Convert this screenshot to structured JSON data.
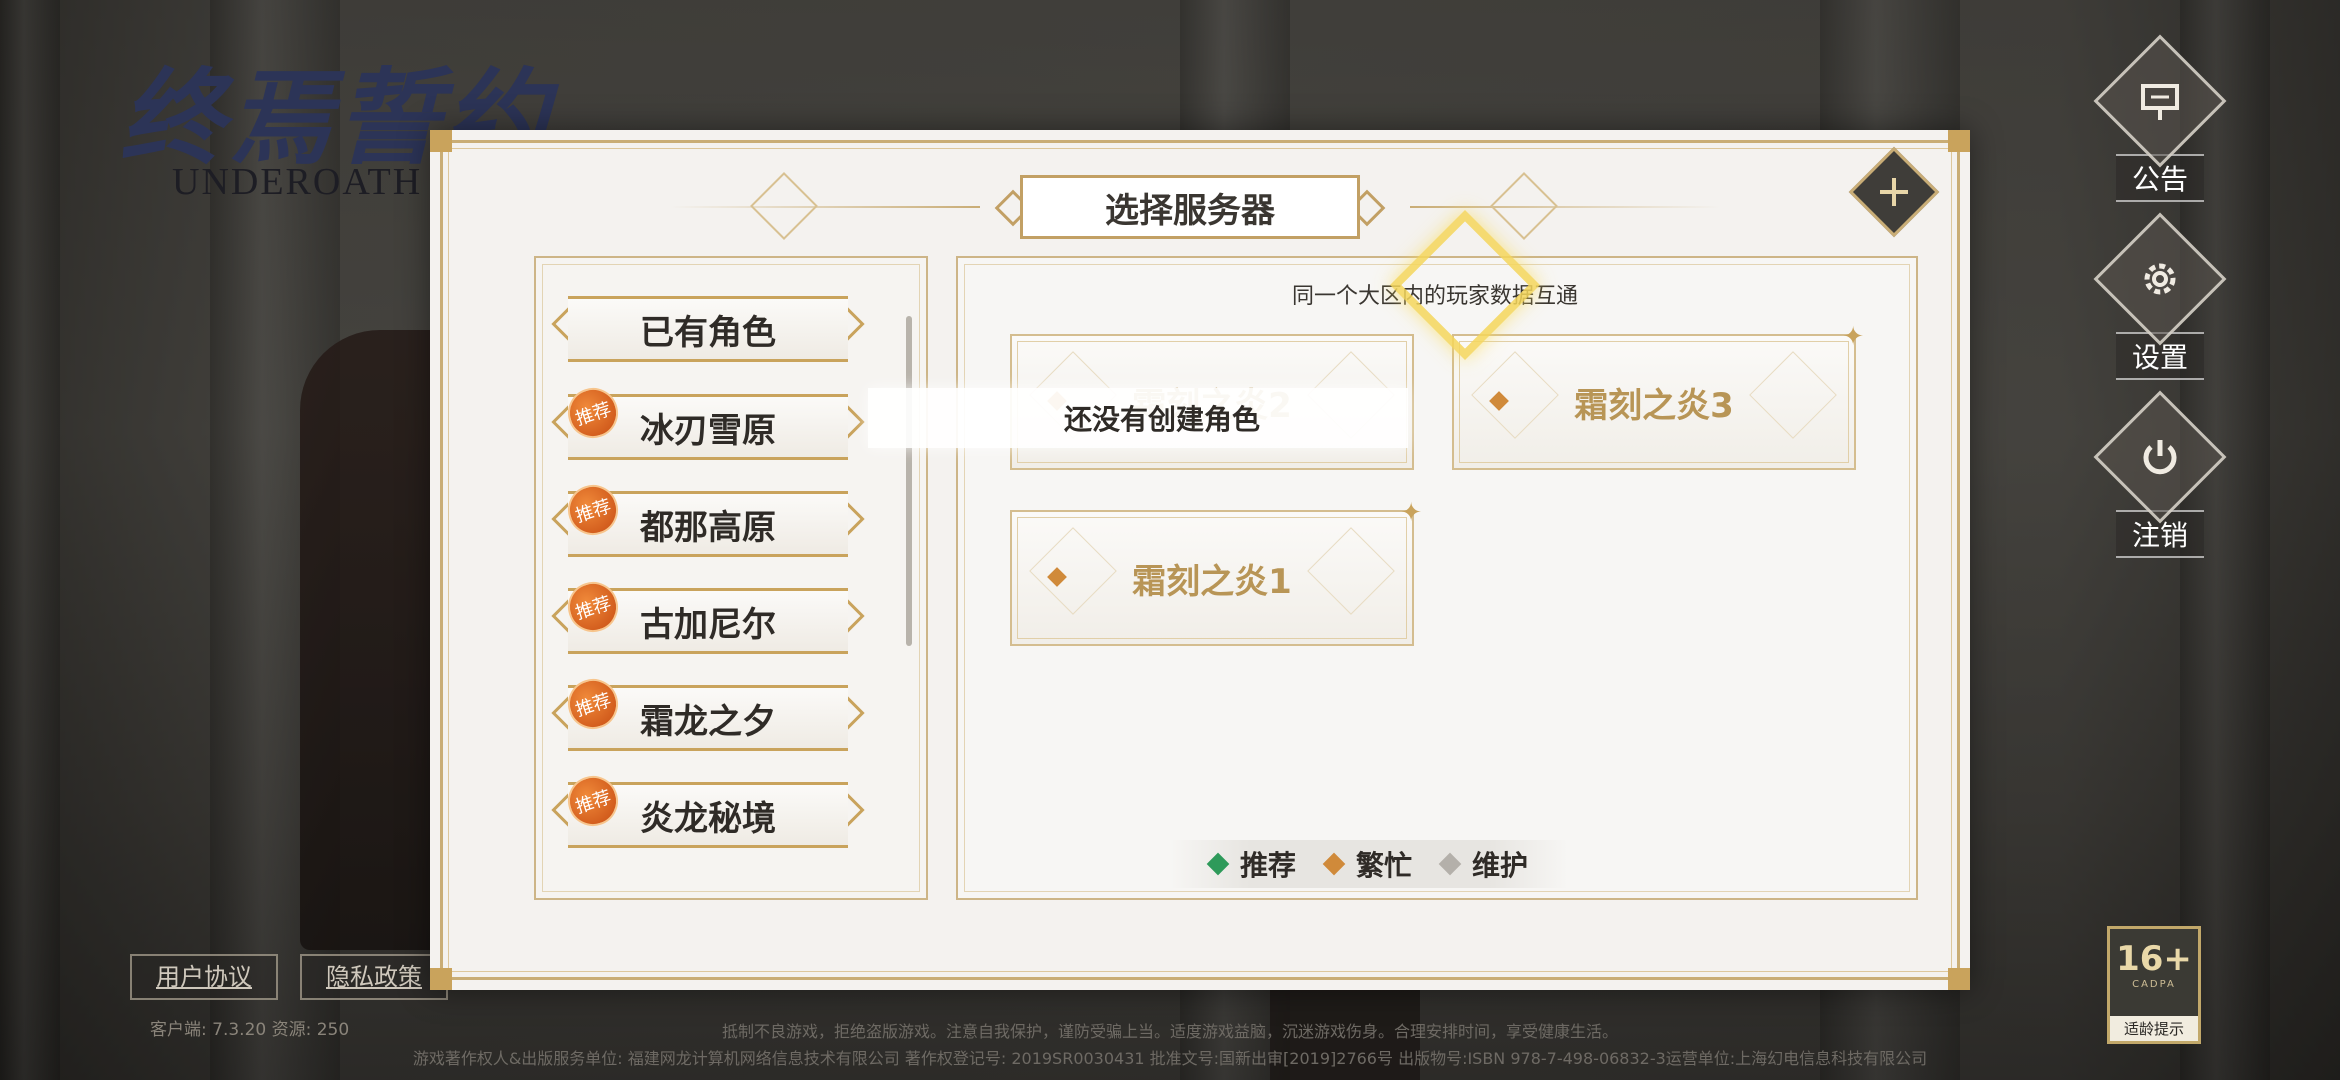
{
  "logo": {
    "cn": "终焉誓约",
    "en": "UNDEROATH"
  },
  "right_menu": [
    {
      "label": "公告",
      "icon": "notice-board-icon"
    },
    {
      "label": "设置",
      "icon": "gear-icon"
    },
    {
      "label": "注销",
      "icon": "power-icon"
    }
  ],
  "bottom_links": {
    "user_agreement": "用户协议",
    "privacy_policy": "隐私政策"
  },
  "version_text": "客户端: 7.3.20  资源: 250",
  "legal": {
    "line1": "抵制不良游戏，拒绝盗版游戏。注意自我保护，谨防受骗上当。适度游戏益脑，沉迷游戏伤身。合理安排时间，享受健康生活。",
    "line2": "游戏著作权人&出版服务单位: 福建网龙计算机网络信息技术有限公司   著作权登记号: 2019SR0030431   批准文号:国新出审[2019]2766号   出版物号:ISBN 978-7-498-06832-3运营单位:上海幻电信息科技有限公司"
  },
  "age_rating": {
    "value": "16+",
    "org": "CADPA",
    "tip": "适龄提示"
  },
  "modal": {
    "title": "选择服务器",
    "hint": "同一个大区内的玩家数据互通",
    "regions": [
      {
        "label": "已有角色",
        "recommended": false
      },
      {
        "label": "冰刃雪原",
        "recommended": true
      },
      {
        "label": "都那高原",
        "recommended": true
      },
      {
        "label": "古加尼尔",
        "recommended": true
      },
      {
        "label": "霜龙之夕",
        "recommended": true
      },
      {
        "label": "炎龙秘境",
        "recommended": true
      }
    ],
    "badge_label": "推荐",
    "servers": [
      {
        "name": "霜刻之炎2",
        "status": "busy"
      },
      {
        "name": "霜刻之炎3",
        "status": "busy"
      },
      {
        "name": "霜刻之炎1",
        "status": "busy"
      }
    ],
    "tooltip": "还没有创建角色",
    "legend": [
      {
        "label": "推荐",
        "color": "#2e9a5a"
      },
      {
        "label": "繁忙",
        "color": "#d08a3a"
      },
      {
        "label": "维护",
        "color": "#b4b0aa"
      }
    ]
  },
  "colors": {
    "gold": "#c9ad76",
    "accent_orange": "#e0641f"
  }
}
